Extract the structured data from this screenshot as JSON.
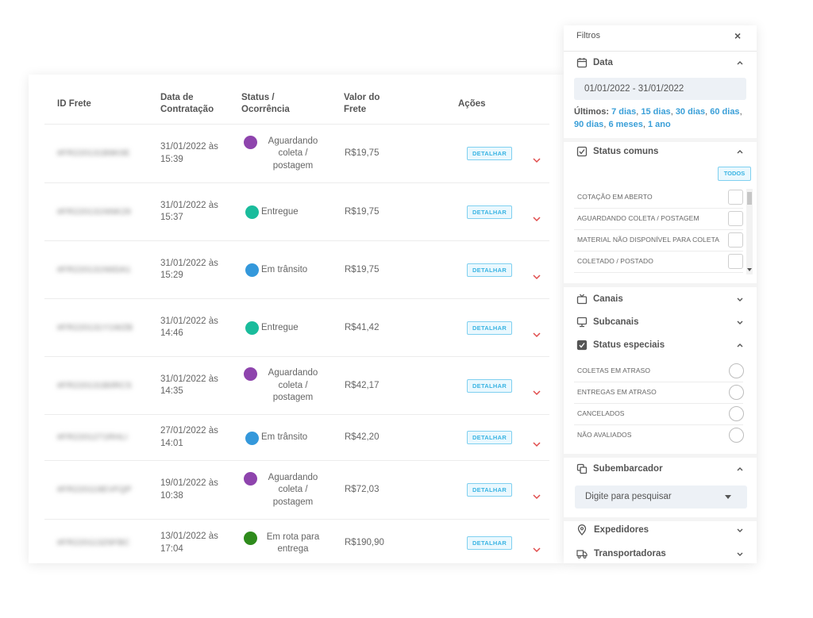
{
  "table": {
    "headers": {
      "id": "ID Frete",
      "data_line1": "Data de",
      "data_line2": "Contratação",
      "status_line1": "Status /",
      "status_line2": "Ocorrência",
      "valor_line1": "Valor do",
      "valor_line2": "Frete",
      "acoes": "Ações"
    },
    "detail_label": "DETALHAR",
    "rows": [
      {
        "id": "#FR220131B9K0E",
        "date1": "31/01/2022 às",
        "date2": "15:39",
        "status": [
          "Aguardando",
          "coleta /",
          "postagem"
        ],
        "status_color": "#8e44ad",
        "valor": "R$19,75"
      },
      {
        "id": "#FR220131NNK29",
        "date1": "31/01/2022 às",
        "date2": "15:37",
        "status": [
          "Entregue"
        ],
        "status_color": "#1abc9c",
        "valor": "R$19,75"
      },
      {
        "id": "#FR220131N6DA1",
        "date1": "31/01/2022 às",
        "date2": "15:29",
        "status": [
          "Em trânsito"
        ],
        "status_color": "#3498db",
        "valor": "R$19,75"
      },
      {
        "id": "#FR220131Y1WZB",
        "date1": "31/01/2022 às",
        "date2": "14:46",
        "status": [
          "Entregue"
        ],
        "status_color": "#1abc9c",
        "valor": "R$41,42"
      },
      {
        "id": "#FR220131B0RCS",
        "date1": "31/01/2022 às",
        "date2": "14:35",
        "status": [
          "Aguardando",
          "coleta /",
          "postagem"
        ],
        "status_color": "#8e44ad",
        "valor": "R$42,17"
      },
      {
        "id": "#FR2201271RHLI",
        "date1": "27/01/2022 às",
        "date2": "14:01",
        "status": [
          "Em trânsito"
        ],
        "status_color": "#3498db",
        "valor": "R$42,20"
      },
      {
        "id": "#FR220119EVFQP",
        "date1": "19/01/2022 às",
        "date2": "10:38",
        "status": [
          "Aguardando",
          "coleta /",
          "postagem"
        ],
        "status_color": "#8e44ad",
        "valor": "R$72,03"
      },
      {
        "id": "#FR220113Z6FBC",
        "date1": "13/01/2022 às",
        "date2": "17:04",
        "status": [
          "Em rota para",
          "entrega"
        ],
        "status_color": "#2e8b1c",
        "valor": "R$190,90"
      }
    ]
  },
  "filters": {
    "title": "Filtros",
    "close": "×",
    "date": {
      "heading": "Data",
      "range": "01/01/2022 - 31/01/2022",
      "ultimos_label": "Últimos:",
      "links": [
        "7 dias",
        "15 dias",
        "30 dias",
        "60 dias",
        "90 dias",
        "6 meses",
        "1 ano"
      ]
    },
    "status_comuns": {
      "heading": "Status comuns",
      "todos": "TODOS",
      "options": [
        "COTAÇÃO EM ABERTO",
        "AGUARDANDO COLETA / POSTAGEM",
        "MATERIAL NÃO DISPONÍVEL PARA COLETA",
        "COLETADO / POSTADO"
      ]
    },
    "canais": "Canais",
    "subcanais": "Subcanais",
    "status_especiais": {
      "heading": "Status especiais",
      "options": [
        "COLETAS EM ATRASO",
        "ENTREGAS EM ATRASO",
        "CANCELADOS",
        "NÃO AVALIADOS"
      ]
    },
    "subembarcador": {
      "heading": "Subembarcador",
      "placeholder": "Digite para pesquisar"
    },
    "expedidores": "Expedidores",
    "transportadoras": "Transportadoras"
  },
  "colors": {
    "accent_link": "#3a9fd8",
    "button_border": "#7fd0f0",
    "chevron_red": "#e04b4b"
  }
}
